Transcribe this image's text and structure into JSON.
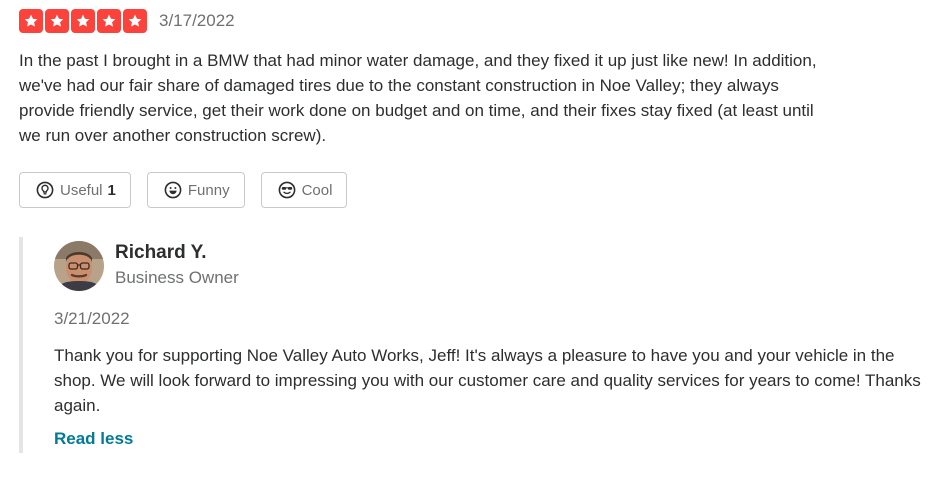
{
  "review": {
    "rating": 5,
    "rating_max": 5,
    "star_color": "#fb433c",
    "date": "3/17/2022",
    "text": "In the past I brought in a BMW that had minor water damage, and they fixed it up just like new! In addition, we've had our fair share of damaged tires due to the constant construction in Noe Valley; they always provide friendly service, get their work done on budget and on time, and their fixes stay fixed (at least until we run over another construction screw).",
    "reactions": [
      {
        "label": "Useful",
        "count": "1",
        "icon": "lightbulb-icon"
      },
      {
        "label": "Funny",
        "count": "",
        "icon": "smiley-icon"
      },
      {
        "label": "Cool",
        "count": "",
        "icon": "sunglasses-smiley-icon"
      }
    ]
  },
  "owner_reply": {
    "name": "Richard Y.",
    "role": "Business Owner",
    "avatar_icon": "owner-avatar",
    "date": "3/21/2022",
    "text": "Thank you for supporting Noe Valley Auto Works, Jeff! It's always a pleasure to have you and your vehicle in the shop. We will look forward to impressing you with our customer care and quality services for years to come! Thanks again.",
    "toggle_label": "Read less",
    "link_color": "#027a97"
  }
}
